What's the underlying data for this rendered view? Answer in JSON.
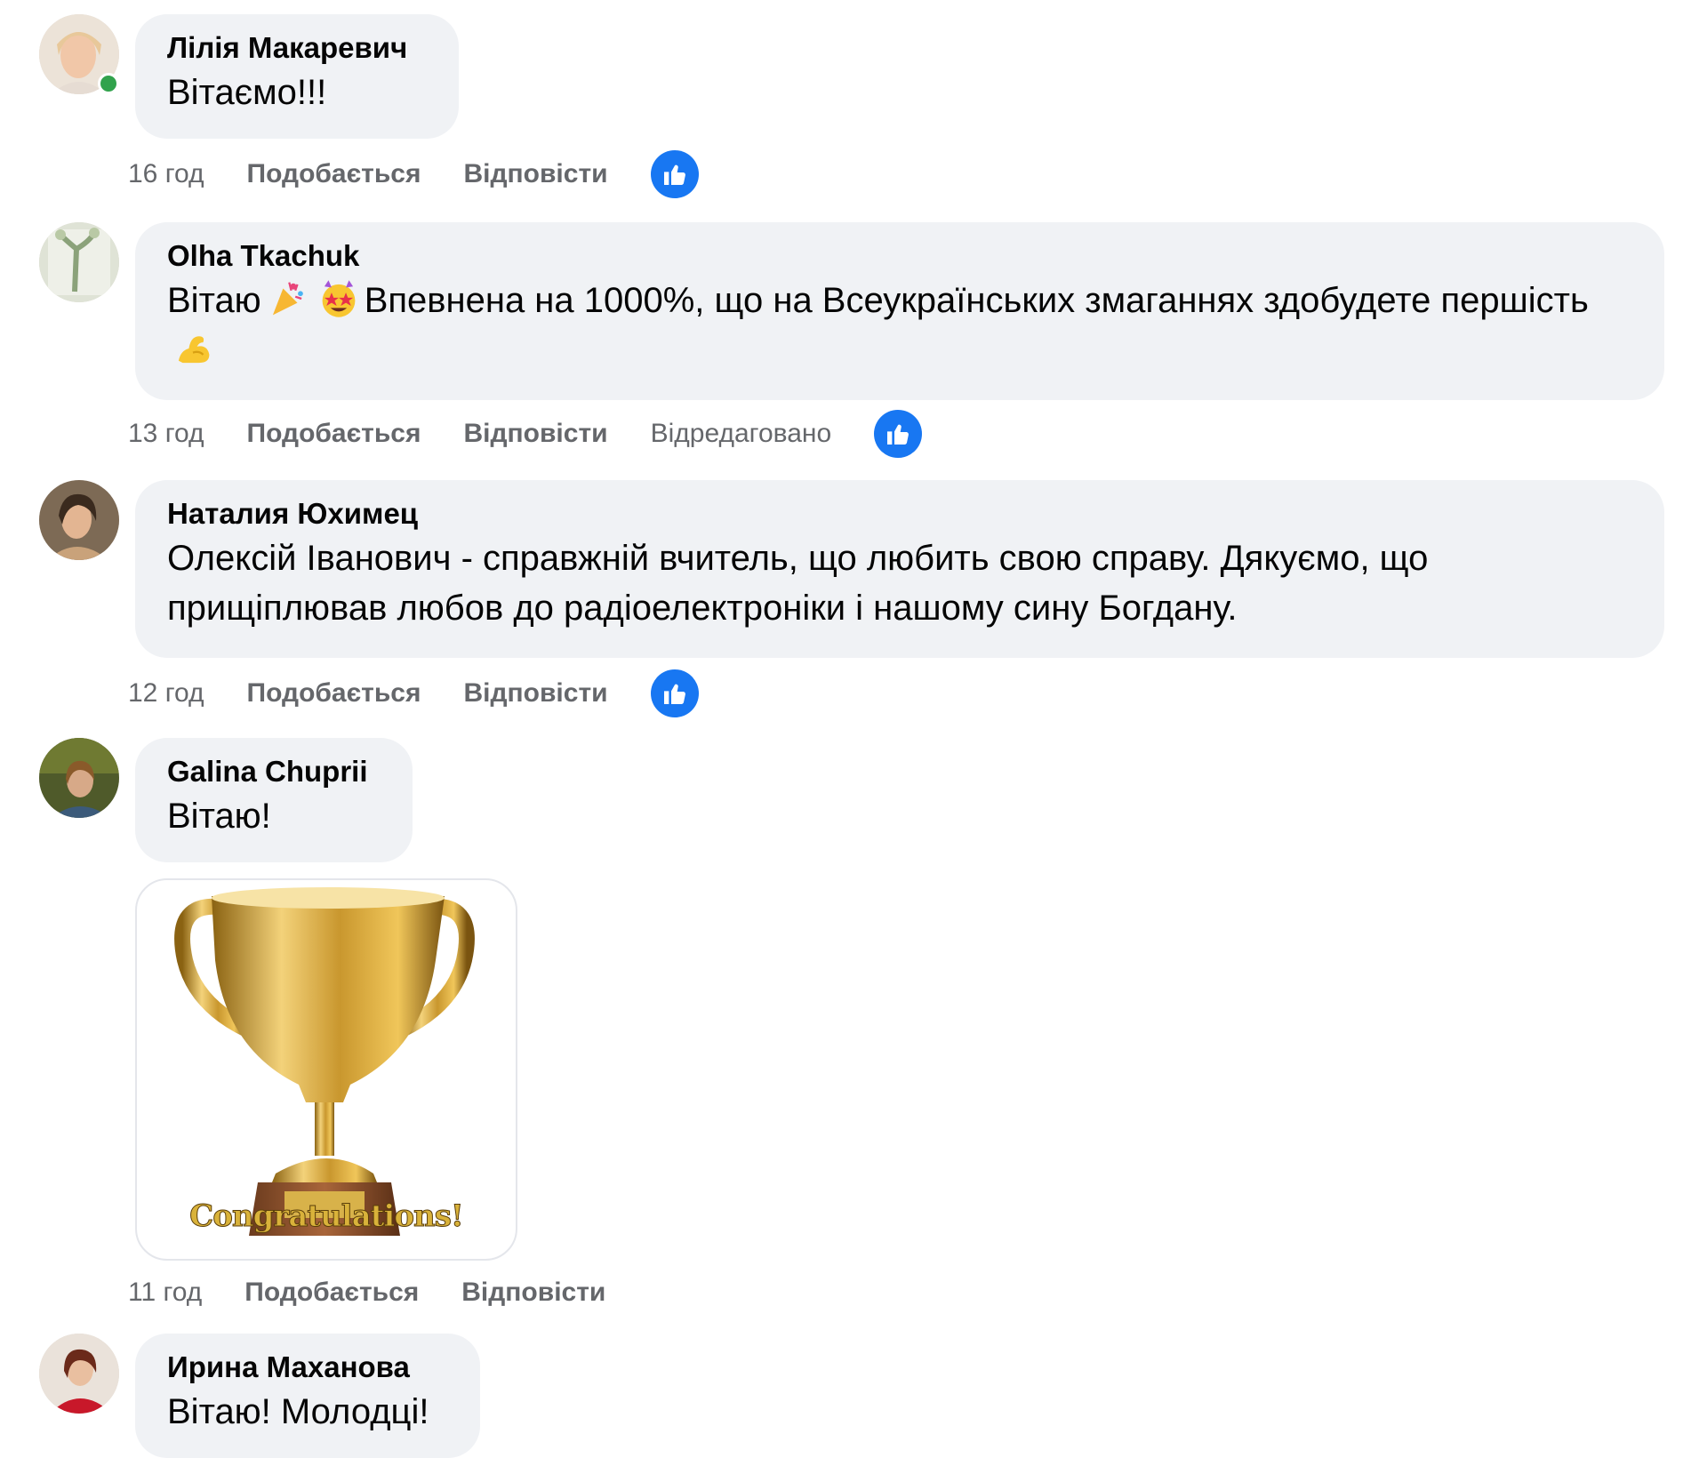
{
  "comments": [
    {
      "author": "Лілія Макаревич",
      "text": "Вітаємо!!!",
      "time": "16 год",
      "like_label": "Подобається",
      "reply_label": "Відповісти",
      "reaction": "like-icon",
      "online": true
    },
    {
      "author": "Olha Tkachuk",
      "text_part1": "Вітаю",
      "text_part2": "Впевнена на 1000%, що на Всеукраїнських змаганнях здобудете першість",
      "emojis": [
        "party-popper-emoji",
        "star-struck-emoji",
        "flexed-biceps-emoji"
      ],
      "time": "13 год",
      "like_label": "Подобається",
      "reply_label": "Відповісти",
      "edited_label": "Відредаговано",
      "reaction": "like-icon"
    },
    {
      "author": "Наталия Юхимец",
      "text": "Олексій Іванович - справжній вчитель, що любить свою справу. Дякуємо, що прищіплював любов до радіоелектроніки і нашому сину Богдану.",
      "time": "12 год",
      "like_label": "Подобається",
      "reply_label": "Відповісти",
      "reaction": "like-icon"
    },
    {
      "author": "Galina Chuprii",
      "text": "Вітаю!",
      "gif_caption": "Congratulations!",
      "gif_icon": "golden-trophy-icon",
      "time": "11 год",
      "like_label": "Подобається",
      "reply_label": "Відповісти"
    },
    {
      "author": "Ирина Маханова",
      "text": "Вітаю! Молодці!"
    }
  ],
  "colors": {
    "bubble": "#f0f2f5",
    "meta_text": "#65676b",
    "like_blue": "#1877f2",
    "online_green": "#31a24c"
  }
}
